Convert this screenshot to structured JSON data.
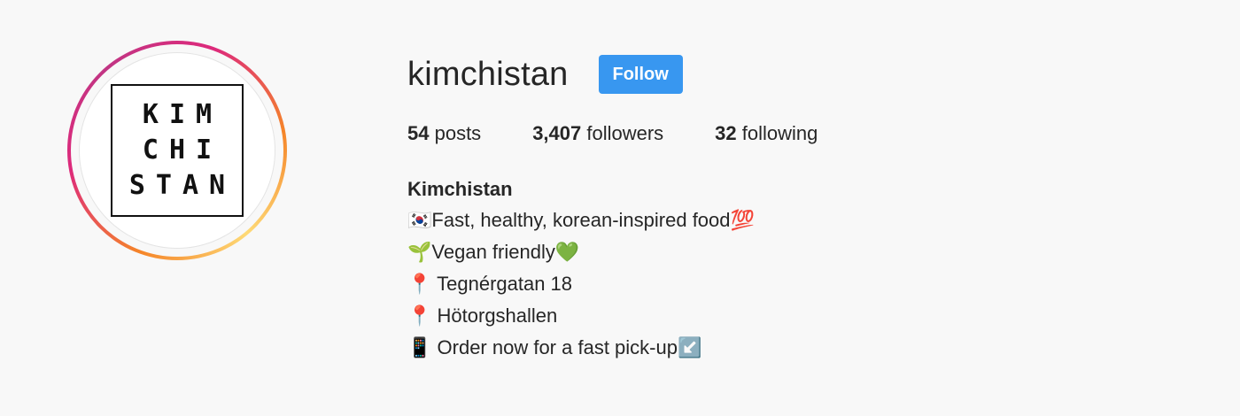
{
  "profile": {
    "avatar_logo_lines": [
      "KIM",
      "CHI",
      "STAN"
    ],
    "username": "kimchistan",
    "follow_label": "Follow",
    "stats": {
      "posts_count": "54",
      "posts_label": " posts",
      "followers_count": "3,407",
      "followers_label": " followers",
      "following_count": "32",
      "following_label": " following"
    },
    "bio": {
      "name": "Kimchistan",
      "lines": [
        {
          "emoji": "🇰🇷",
          "text": "Fast, healthy, korean-inspired food",
          "trail": "💯"
        },
        {
          "emoji": "🌱",
          "text": "Vegan friendly",
          "trail": "💚"
        },
        {
          "emoji": "📍",
          "text": " Tegnérgatan 18",
          "trail": ""
        },
        {
          "emoji": "📍",
          "text": " Hötorgshallen",
          "trail": ""
        },
        {
          "emoji": "📱",
          "text": " Order now for a fast pick-up",
          "trail": "↙️"
        }
      ]
    }
  },
  "colors": {
    "follow_button": "#3897f0",
    "background": "#f8f8f8",
    "text": "#262626"
  }
}
